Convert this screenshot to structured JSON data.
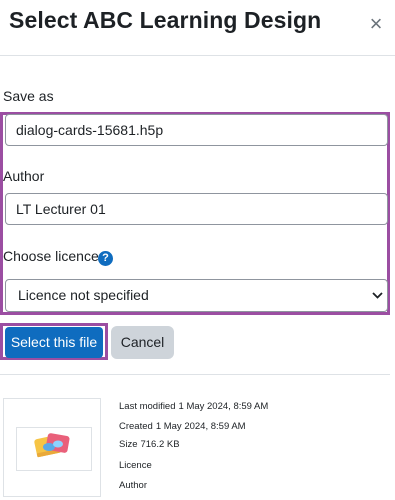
{
  "dialog": {
    "title": "Select ABC Learning Design",
    "close_glyph": "×"
  },
  "form": {
    "save_as_label": "Save as",
    "save_as_value": "dialog-cards-15681.h5p",
    "author_label": "Author",
    "author_value": "LT Lecturer 01",
    "licence_label": "Choose licence",
    "help_glyph": "?",
    "licence_selected": "Licence not specified"
  },
  "buttons": {
    "select_label": "Select this file",
    "cancel_label": "Cancel"
  },
  "file_info": {
    "last_modified_label": "Last modified",
    "last_modified_value": "1 May 2024, 8:59 AM",
    "created_label": "Created",
    "created_value": "1 May 2024, 8:59 AM",
    "size_label": "Size",
    "size_value": "716.2 KB",
    "licence_label": "Licence",
    "author_label": "Author"
  },
  "icons": {
    "close": "close-icon",
    "help": "help-icon",
    "chevron": "chevron-down-icon",
    "thumbnail": "dialog-cards-icon"
  },
  "colors": {
    "primary": "#0f6cbf",
    "highlight": "#9b4ea2",
    "secondary_button": "#ced4da"
  }
}
